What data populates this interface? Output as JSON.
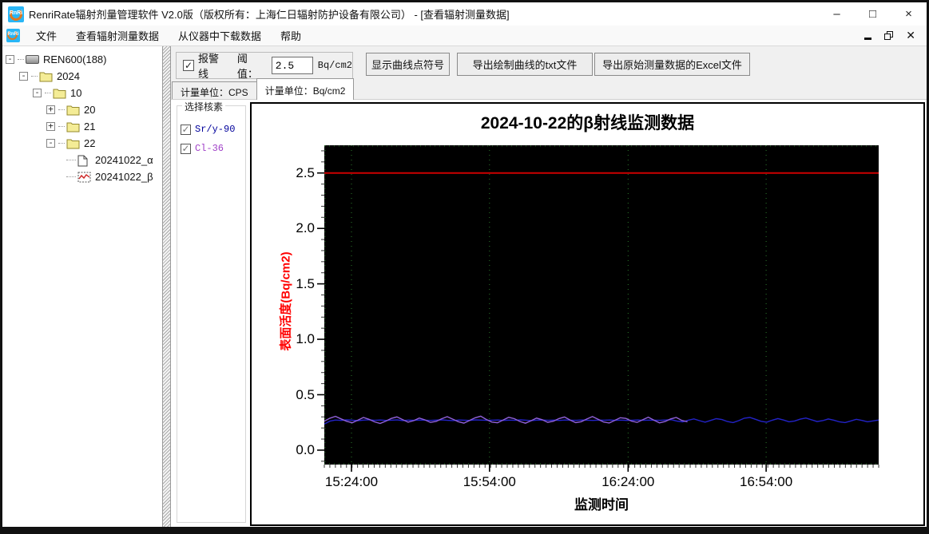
{
  "window": {
    "title": "RenriRate辐射剂量管理软件 V2.0版（版权所有：上海仁日辐射防护设备有限公司） - [查看辐射测量数据]",
    "app_icon_text": "RnRi",
    "minimize": "–",
    "maximize": "□",
    "close": "×"
  },
  "menu": {
    "items": [
      "文件",
      "查看辐射测量数据",
      "从仪器中下载数据",
      "帮助"
    ]
  },
  "tree": {
    "items": [
      {
        "label": "REN600(188)",
        "expander": "-",
        "icon": "device"
      },
      {
        "label": "2024",
        "expander": "-",
        "icon": "folder"
      },
      {
        "label": "10",
        "expander": "-",
        "icon": "folder"
      },
      {
        "label": "20",
        "expander": "+",
        "icon": "folder"
      },
      {
        "label": "21",
        "expander": "+",
        "icon": "folder"
      },
      {
        "label": "22",
        "expander": "-",
        "icon": "folder"
      },
      {
        "label": "20241022_α",
        "expander": "",
        "icon": "document"
      },
      {
        "label": "20241022_β",
        "expander": "",
        "icon": "chart-file"
      }
    ]
  },
  "toolbar": {
    "alarm_checkbox_label": "报警线",
    "alarm_checked": "✓",
    "threshold_label": "阈值：",
    "threshold_value": "2.5",
    "threshold_unit": "Bq/cm2",
    "show_points_button": "显示曲线点符号",
    "export_txt_button": "导出绘制曲线的txt文件",
    "export_excel_button": "导出原始测量数据的Excel文件"
  },
  "tabs": [
    {
      "label": "计量单位：CPS",
      "active": false
    },
    {
      "label": "计量单位：Bq/cm2",
      "active": true
    }
  ],
  "nuclide_panel": {
    "title": "选择核素",
    "items": [
      {
        "label": "Sr/y-90",
        "checked": "✓",
        "color": "#00009b"
      },
      {
        "label": "Cl-36",
        "checked": "✓",
        "color": "#a040c8"
      }
    ]
  },
  "chart_data": {
    "type": "line",
    "title": "2024-10-22的β射线监测数据",
    "xlabel": "监测时间",
    "ylabel": "表面活度(Bq/cm2)",
    "plot_bg": "#000000",
    "grid": {
      "color": "#2d7d2d",
      "style": "dotted"
    },
    "ylim": [
      -0.13,
      2.75
    ],
    "yticks": [
      0.0,
      0.5,
      1.0,
      1.5,
      2.0,
      2.5
    ],
    "xticks": [
      {
        "frac": 0.049,
        "label": "15:24:00"
      },
      {
        "frac": 0.298,
        "label": "15:54:00"
      },
      {
        "frac": 0.548,
        "label": "16:24:00"
      },
      {
        "frac": 0.797,
        "label": "16:54:00"
      }
    ],
    "x_minor_tick_count": 100,
    "y_minor_tick_step": 0.1,
    "alarm_line": {
      "value": 2.5,
      "color": "#cc0000"
    },
    "series": [
      {
        "name": "Sr/y-90",
        "color": "#2323c8",
        "x_start": 0,
        "x_end": 1,
        "values": [
          0.235,
          0.262,
          0.272,
          0.268,
          0.273,
          0.27,
          0.266,
          0.271,
          0.274,
          0.269,
          0.272,
          0.268,
          0.27,
          0.273,
          0.267,
          0.271,
          0.269,
          0.272,
          0.27,
          0.268,
          0.271,
          0.273,
          0.269,
          0.267,
          0.272,
          0.27,
          0.268,
          0.273,
          0.271,
          0.269,
          0.27,
          0.272,
          0.268,
          0.271,
          0.269,
          0.273,
          0.27,
          0.267,
          0.271,
          0.272,
          0.269,
          0.271,
          0.268,
          0.272,
          0.27,
          0.269,
          0.272,
          0.27,
          0.268,
          0.271,
          0.27,
          0.272,
          0.269,
          0.271,
          0.268,
          0.27,
          0.272,
          0.269,
          0.271,
          0.27,
          0.269,
          0.272,
          0.275,
          0.262,
          0.255,
          0.27,
          0.282,
          0.266,
          0.252,
          0.268,
          0.284,
          0.276,
          0.258,
          0.249,
          0.266,
          0.288,
          0.295,
          0.278,
          0.26,
          0.252,
          0.27,
          0.285,
          0.272,
          0.256,
          0.263,
          0.28,
          0.29,
          0.274,
          0.258,
          0.266,
          0.281,
          0.27,
          0.255,
          0.249,
          0.263,
          0.278,
          0.268,
          0.256,
          0.264,
          0.272
        ]
      },
      {
        "name": "Cl-36",
        "color": "#9060d8",
        "x_start": 0,
        "x_end": 0.655,
        "values": [
          0.262,
          0.288,
          0.305,
          0.282,
          0.26,
          0.247,
          0.27,
          0.295,
          0.278,
          0.255,
          0.241,
          0.262,
          0.286,
          0.3,
          0.276,
          0.252,
          0.266,
          0.29,
          0.273,
          0.25,
          0.259,
          0.283,
          0.302,
          0.28,
          0.257,
          0.244,
          0.268,
          0.292,
          0.306,
          0.277,
          0.253,
          0.247,
          0.271,
          0.296,
          0.284,
          0.259,
          0.243,
          0.265,
          0.289,
          0.275,
          0.251,
          0.261,
          0.285,
          0.299,
          0.272,
          0.248,
          0.257,
          0.281,
          0.303,
          0.279,
          0.254,
          0.245,
          0.269,
          0.293,
          0.286,
          0.262,
          0.25,
          0.274,
          0.298,
          0.27,
          0.246,
          0.258,
          0.282,
          0.295,
          0.268,
          0.256
        ]
      }
    ]
  }
}
